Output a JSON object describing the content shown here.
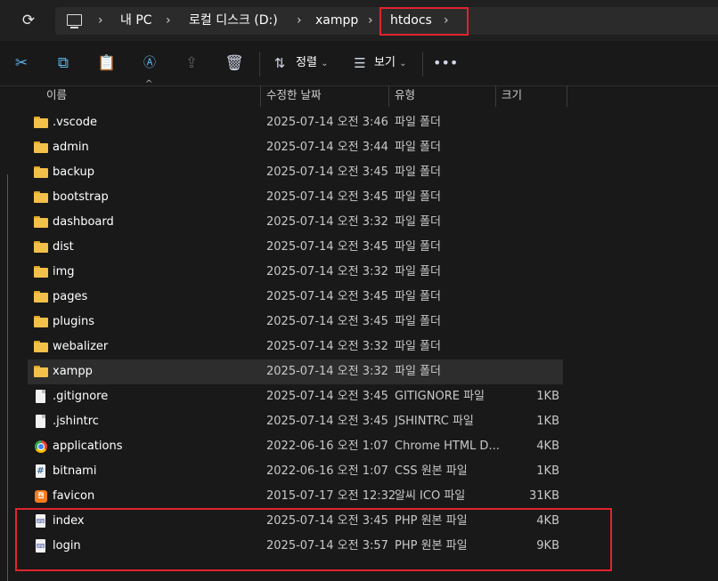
{
  "address": {
    "crumbs": [
      "내 PC",
      "로컬 디스크 (D:)",
      "xampp",
      "htdocs"
    ]
  },
  "toolbar": {
    "sort_label": "정렬",
    "view_label": "보기"
  },
  "columns": {
    "name": "이름",
    "date": "수정한 날짜",
    "type": "유형",
    "size": "크기"
  },
  "files": [
    {
      "name": ".vscode",
      "date": "2025-07-14 오전 3:46",
      "type": "파일 폴더",
      "size": "",
      "icon": "folder-icon"
    },
    {
      "name": "admin",
      "date": "2025-07-14 오전 3:44",
      "type": "파일 폴더",
      "size": "",
      "icon": "folder-icon"
    },
    {
      "name": "backup",
      "date": "2025-07-14 오전 3:45",
      "type": "파일 폴더",
      "size": "",
      "icon": "folder-icon"
    },
    {
      "name": "bootstrap",
      "date": "2025-07-14 오전 3:45",
      "type": "파일 폴더",
      "size": "",
      "icon": "folder-icon"
    },
    {
      "name": "dashboard",
      "date": "2025-07-14 오전 3:32",
      "type": "파일 폴더",
      "size": "",
      "icon": "folder-icon"
    },
    {
      "name": "dist",
      "date": "2025-07-14 오전 3:45",
      "type": "파일 폴더",
      "size": "",
      "icon": "folder-icon"
    },
    {
      "name": "img",
      "date": "2025-07-14 오전 3:32",
      "type": "파일 폴더",
      "size": "",
      "icon": "folder-icon"
    },
    {
      "name": "pages",
      "date": "2025-07-14 오전 3:45",
      "type": "파일 폴더",
      "size": "",
      "icon": "folder-icon"
    },
    {
      "name": "plugins",
      "date": "2025-07-14 오전 3:45",
      "type": "파일 폴더",
      "size": "",
      "icon": "folder-icon"
    },
    {
      "name": "webalizer",
      "date": "2025-07-14 오전 3:32",
      "type": "파일 폴더",
      "size": "",
      "icon": "folder-icon"
    },
    {
      "name": "xampp",
      "date": "2025-07-14 오전 3:32",
      "type": "파일 폴더",
      "size": "",
      "icon": "folder-icon"
    },
    {
      "name": ".gitignore",
      "date": "2025-07-14 오전 3:45",
      "type": "GITIGNORE 파일",
      "size": "1KB",
      "icon": "file-icon"
    },
    {
      "name": ".jshintrc",
      "date": "2025-07-14 오전 3:45",
      "type": "JSHINTRC 파일",
      "size": "1KB",
      "icon": "file-icon"
    },
    {
      "name": "applications",
      "date": "2022-06-16 오전 1:07",
      "type": "Chrome HTML D...",
      "size": "4KB",
      "icon": "chrome-html-icon"
    },
    {
      "name": "bitnami",
      "date": "2022-06-16 오전 1:07",
      "type": "CSS 원본 파일",
      "size": "1KB",
      "icon": "css-file-icon"
    },
    {
      "name": "favicon",
      "date": "2015-07-17 오전 12:32",
      "type": "알씨 ICO 파일",
      "size": "31KB",
      "icon": "xampp-ico-icon"
    },
    {
      "name": "index",
      "date": "2025-07-14 오전 3:45",
      "type": "PHP 원본 파일",
      "size": "4KB",
      "icon": "php-file-icon"
    },
    {
      "name": "login",
      "date": "2025-07-14 오전 3:57",
      "type": "PHP 원본 파일",
      "size": "9KB",
      "icon": "php-file-icon"
    }
  ],
  "selected_row": "xampp",
  "accent_colors": {
    "highlight_box": "#e0242c",
    "folder": "#f3c04a"
  }
}
